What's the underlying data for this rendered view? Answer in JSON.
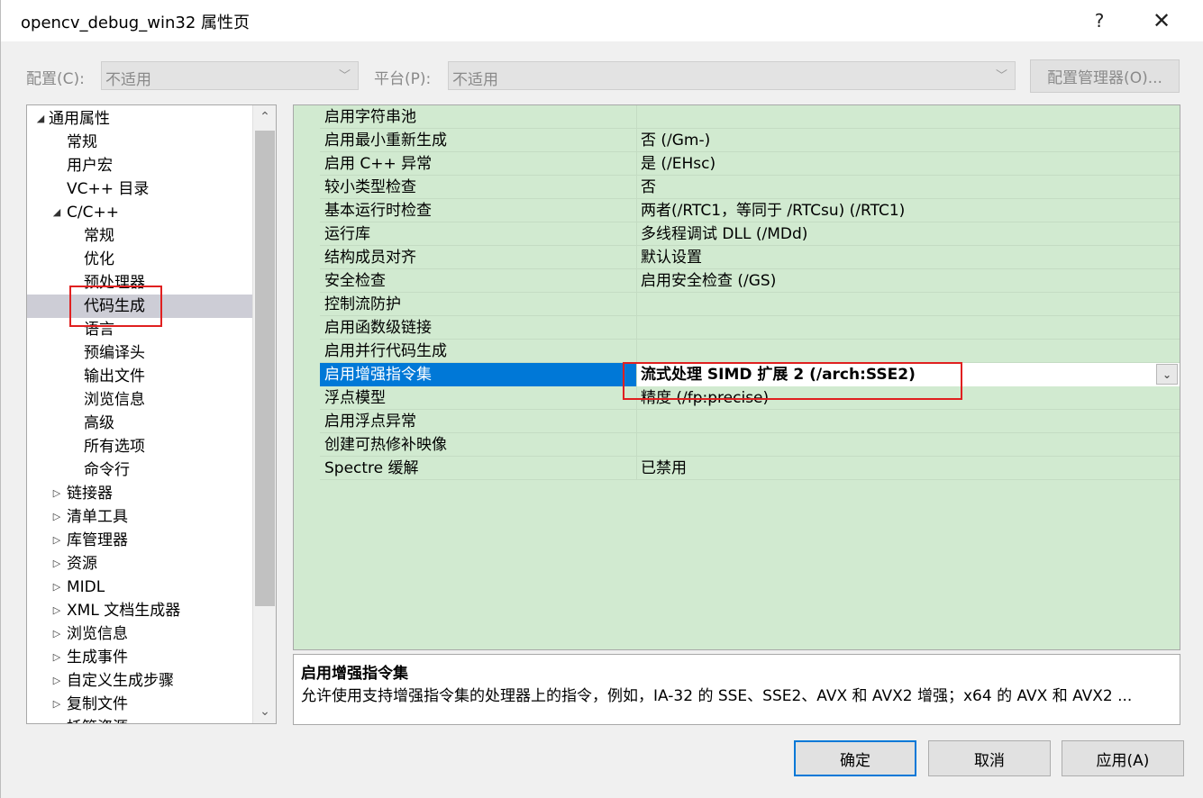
{
  "window": {
    "title": "opencv_debug_win32 属性页",
    "help_glyph": "?",
    "close_glyph": "✕"
  },
  "config": {
    "config_label": "配置(C):",
    "config_value": "不适用",
    "platform_label": "平台(P):",
    "platform_value": "不适用",
    "manager_label": "配置管理器(O)..."
  },
  "tree": {
    "items": [
      {
        "label": "通用属性",
        "expander": "◢",
        "level": 0
      },
      {
        "label": "常规",
        "expander": "",
        "level": 1
      },
      {
        "label": "用户宏",
        "expander": "",
        "level": 1
      },
      {
        "label": "VC++ 目录",
        "expander": "",
        "level": 1
      },
      {
        "label": "C/C++",
        "expander": "◢",
        "level": 1
      },
      {
        "label": "常规",
        "expander": "",
        "level": 2
      },
      {
        "label": "优化",
        "expander": "",
        "level": 2
      },
      {
        "label": "预处理器",
        "expander": "",
        "level": 2
      },
      {
        "label": "代码生成",
        "expander": "",
        "level": 2,
        "selected": true
      },
      {
        "label": "语言",
        "expander": "",
        "level": 2
      },
      {
        "label": "预编译头",
        "expander": "",
        "level": 2
      },
      {
        "label": "输出文件",
        "expander": "",
        "level": 2
      },
      {
        "label": "浏览信息",
        "expander": "",
        "level": 2
      },
      {
        "label": "高级",
        "expander": "",
        "level": 2
      },
      {
        "label": "所有选项",
        "expander": "",
        "level": 2
      },
      {
        "label": "命令行",
        "expander": "",
        "level": 2
      },
      {
        "label": "链接器",
        "expander": "▷",
        "level": 1
      },
      {
        "label": "清单工具",
        "expander": "▷",
        "level": 1
      },
      {
        "label": "库管理器",
        "expander": "▷",
        "level": 1
      },
      {
        "label": "资源",
        "expander": "▷",
        "level": 1
      },
      {
        "label": "MIDL",
        "expander": "▷",
        "level": 1
      },
      {
        "label": "XML 文档生成器",
        "expander": "▷",
        "level": 1
      },
      {
        "label": "浏览信息",
        "expander": "▷",
        "level": 1
      },
      {
        "label": "生成事件",
        "expander": "▷",
        "level": 1
      },
      {
        "label": "自定义生成步骤",
        "expander": "▷",
        "level": 1
      },
      {
        "label": "复制文件",
        "expander": "▷",
        "level": 1
      },
      {
        "label": "托管资源",
        "expander": "▷",
        "level": 1
      }
    ],
    "scroll_up_glyph": "⌃",
    "scroll_down_glyph": "⌄"
  },
  "grid": {
    "rows": [
      {
        "name": "启用字符串池",
        "value": ""
      },
      {
        "name": "启用最小重新生成",
        "value": "否 (/Gm-)"
      },
      {
        "name": "启用 C++ 异常",
        "value": "是 (/EHsc)"
      },
      {
        "name": "较小类型检查",
        "value": "否"
      },
      {
        "name": "基本运行时检查",
        "value": "两者(/RTC1，等同于 /RTCsu) (/RTC1)"
      },
      {
        "name": "运行库",
        "value": "多线程调试 DLL (/MDd)"
      },
      {
        "name": "结构成员对齐",
        "value": "默认设置"
      },
      {
        "name": "安全检查",
        "value": "启用安全检查 (/GS)"
      },
      {
        "name": "控制流防护",
        "value": ""
      },
      {
        "name": "启用函数级链接",
        "value": ""
      },
      {
        "name": "启用并行代码生成",
        "value": ""
      },
      {
        "name": "启用增强指令集",
        "value": "流式处理 SIMD 扩展 2 (/arch:SSE2)",
        "selected": true
      },
      {
        "name": "浮点模型",
        "value": "精度 (/fp:precise)"
      },
      {
        "name": "启用浮点异常",
        "value": ""
      },
      {
        "name": "创建可热修补映像",
        "value": ""
      },
      {
        "name": "Spectre 缓解",
        "value": "已禁用"
      }
    ],
    "dropdown_glyph": "⌄"
  },
  "description": {
    "title": "启用增强指令集",
    "text": "允许使用支持增强指令集的处理器上的指令，例如，IA-32 的 SSE、SSE2、AVX 和 AVX2 增强；x64 的 AVX 和 AVX2 ..."
  },
  "buttons": {
    "ok": "确定",
    "cancel": "取消",
    "apply": "应用(A)"
  },
  "colors": {
    "grid_bg": "#d1ead0",
    "selection_blue": "#0078d7",
    "annotation_red": "#e02020"
  }
}
